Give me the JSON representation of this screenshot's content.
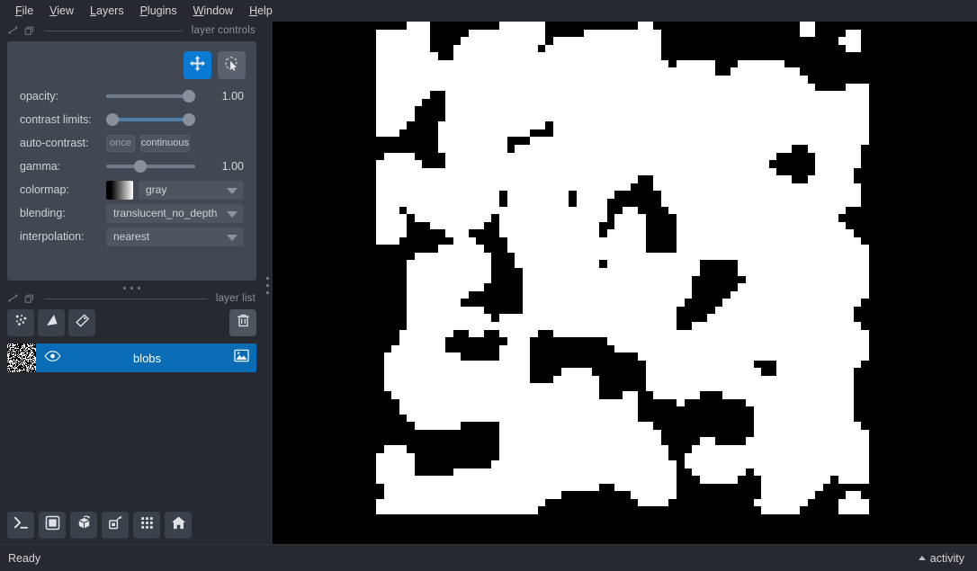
{
  "menu": {
    "items": [
      {
        "label": "File",
        "accel": "F"
      },
      {
        "label": "View",
        "accel": "V"
      },
      {
        "label": "Layers",
        "accel": "L"
      },
      {
        "label": "Plugins",
        "accel": "P"
      },
      {
        "label": "Window",
        "accel": "W"
      },
      {
        "label": "Help",
        "accel": "H"
      }
    ]
  },
  "layer_controls": {
    "dock_title": "layer controls",
    "mode_buttons": [
      {
        "name": "pan-zoom",
        "icon": "move-icon",
        "active": true
      },
      {
        "name": "transform",
        "icon": "transform-icon",
        "active": false
      }
    ],
    "opacity": {
      "label": "opacity:",
      "value": "1.00",
      "percent": 100
    },
    "contrast_limits": {
      "label": "contrast limits:",
      "low_percent": 0,
      "high_percent": 100
    },
    "auto_contrast": {
      "label": "auto-contrast:",
      "once": "once",
      "continuous": "continuous"
    },
    "gamma": {
      "label": "gamma:",
      "value": "1.00",
      "percent": 37
    },
    "colormap": {
      "label": "colormap:",
      "value": "gray"
    },
    "blending": {
      "label": "blending:",
      "value": "translucent_no_depth"
    },
    "interpolation": {
      "label": "interpolation:",
      "value": "nearest"
    }
  },
  "layer_list": {
    "dock_title": "layer list",
    "tools": [
      {
        "name": "new-points-layer-button",
        "icon": "points-icon"
      },
      {
        "name": "new-shapes-layer-button",
        "icon": "shapes-icon"
      },
      {
        "name": "new-labels-layer-button",
        "icon": "labels-icon"
      },
      {
        "name": "delete-layer-button",
        "icon": "trash-icon"
      }
    ],
    "layers": [
      {
        "name": "blobs",
        "visible": true,
        "selected": true,
        "type_icon": "image-icon"
      }
    ]
  },
  "viewer_buttons": [
    {
      "name": "console-button",
      "icon": "console-icon"
    },
    {
      "name": "ndisplay-toggle-button",
      "icon": "square-icon"
    },
    {
      "name": "roll-dims-button",
      "icon": "cube-icon"
    },
    {
      "name": "transpose-dims-button",
      "icon": "transpose-icon"
    },
    {
      "name": "grid-view-button",
      "icon": "grid-icon"
    },
    {
      "name": "home-button",
      "icon": "home-icon"
    }
  ],
  "status": {
    "text": "Ready",
    "activity_label": "activity"
  },
  "canvas": {
    "layer_name": "blobs",
    "background": "#000000",
    "foreground": "#ffffff"
  },
  "colors": {
    "accent": "#0a7bd4",
    "selection": "#0a6cb4",
    "panel": "#414851",
    "background": "#262930",
    "control": "#4e555f"
  }
}
